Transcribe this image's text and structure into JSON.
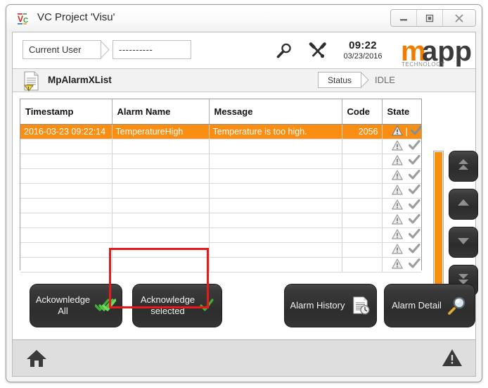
{
  "window": {
    "title": "VC Project 'Visu'",
    "logo_icon": "vc-logo-icon",
    "controls": [
      {
        "name": "minimize-button",
        "icon": "minimize-icon"
      },
      {
        "name": "maximize-button",
        "icon": "maximize-icon"
      },
      {
        "name": "close-button",
        "icon": "close-icon"
      }
    ]
  },
  "toolbar": {
    "user_label": "Current User",
    "user_value": "----------",
    "search_icon": "magnifier-icon",
    "tools_icon": "wrench-screwdriver-icon",
    "clock_time": "09:22",
    "clock_date": "03/23/2016",
    "brand": {
      "m": "m",
      "app": "app",
      "sub": "TECHNOLOGY"
    }
  },
  "widget_header": {
    "icon": "document-warning-icon",
    "title": "MpAlarmXList",
    "status_label": "Status",
    "status_value": "IDLE"
  },
  "table": {
    "columns": [
      "Timestamp",
      "Alarm Name",
      "Message",
      "Code",
      "State"
    ],
    "rows": [
      {
        "timestamp": "2016-03-23 09:22:14",
        "alarm_name": "TemperatureHigh",
        "message": "Temperature is too high.",
        "code": "2056",
        "state_icons": [
          "warning-triangle-icon",
          "separator",
          "check-icon"
        ],
        "selected": true
      },
      {
        "timestamp": "",
        "alarm_name": "",
        "message": "",
        "code": "",
        "state_icons": [
          "warning-triangle-icon",
          "check-icon"
        ],
        "selected": false
      },
      {
        "timestamp": "",
        "alarm_name": "",
        "message": "",
        "code": "",
        "state_icons": [
          "warning-triangle-icon",
          "check-icon"
        ],
        "selected": false
      },
      {
        "timestamp": "",
        "alarm_name": "",
        "message": "",
        "code": "",
        "state_icons": [
          "warning-triangle-icon",
          "check-icon"
        ],
        "selected": false
      },
      {
        "timestamp": "",
        "alarm_name": "",
        "message": "",
        "code": "",
        "state_icons": [
          "warning-triangle-icon",
          "check-icon"
        ],
        "selected": false
      },
      {
        "timestamp": "",
        "alarm_name": "",
        "message": "",
        "code": "",
        "state_icons": [
          "warning-triangle-icon",
          "check-icon"
        ],
        "selected": false
      },
      {
        "timestamp": "",
        "alarm_name": "",
        "message": "",
        "code": "",
        "state_icons": [
          "warning-triangle-icon",
          "check-icon"
        ],
        "selected": false
      },
      {
        "timestamp": "",
        "alarm_name": "",
        "message": "",
        "code": "",
        "state_icons": [
          "warning-triangle-icon",
          "check-icon"
        ],
        "selected": false
      },
      {
        "timestamp": "",
        "alarm_name": "",
        "message": "",
        "code": "",
        "state_icons": [
          "warning-triangle-icon",
          "check-icon"
        ],
        "selected": false
      },
      {
        "timestamp": "",
        "alarm_name": "",
        "message": "",
        "code": "",
        "state_icons": [
          "warning-triangle-icon",
          "check-icon"
        ],
        "selected": false
      }
    ]
  },
  "scroll": {
    "thumb_color": "#f7900d",
    "buttons": [
      {
        "name": "scroll-first-button",
        "icon": "double-up-arrow-icon"
      },
      {
        "name": "scroll-up-button",
        "icon": "up-arrow-icon"
      },
      {
        "name": "scroll-down-button",
        "icon": "down-arrow-icon"
      },
      {
        "name": "scroll-last-button",
        "icon": "double-down-arrow-icon"
      }
    ]
  },
  "actions": {
    "acknowledge_all_line1": "Ackownledge",
    "acknowledge_all_line2": "All",
    "acknowledge_all_icon": "triple-check-icon",
    "acknowledge_selected_line1": "Acknowledge",
    "acknowledge_selected_line2": "selected",
    "acknowledge_selected_icon": "check-icon",
    "alarm_history": "Alarm History",
    "alarm_history_icon": "document-clock-icon",
    "alarm_detail": "Alarm Detail",
    "alarm_detail_icon": "magnifier-icon"
  },
  "statusbar": {
    "home_icon": "home-icon",
    "warning_icon": "warning-triangle-icon"
  },
  "annotation": {
    "highlight_color": "#e8191b",
    "target": "acknowledge-selected-button"
  },
  "colors": {
    "selection_orange": "#f98e12",
    "brand_orange": "#f07d00",
    "button_dark": "#2d2d2d",
    "check_green": "#3cb034"
  }
}
